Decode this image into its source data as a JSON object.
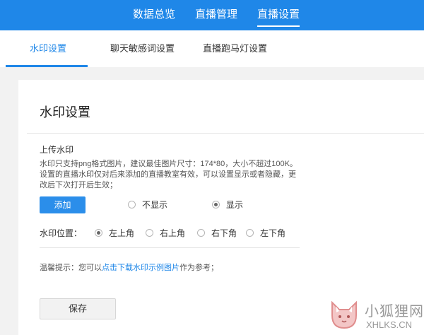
{
  "top_nav": {
    "items": [
      {
        "label": "数据总览"
      },
      {
        "label": "直播管理"
      },
      {
        "label": "直播设置"
      }
    ],
    "active_index": 2
  },
  "sub_tabs": {
    "items": [
      {
        "label": "水印设置"
      },
      {
        "label": "聊天敏感词设置"
      },
      {
        "label": "直播跑马灯设置"
      }
    ],
    "active_index": 0
  },
  "panel": {
    "title": "水印设置",
    "upload_label": "上传水印",
    "description": "水印只支持png格式图片，建议最佳图片尺寸：174*80，大小不超过100K。设置的直播水印仅对后来添加的直播教室有效，可以设置显示或者隐藏，更改后下次打开后生效；",
    "add_button": "添加",
    "visibility": {
      "options": [
        "不显示",
        "显示"
      ],
      "selected": "显示"
    },
    "position": {
      "label": "水印位置：",
      "options": [
        "左上角",
        "右上角",
        "右下角",
        "左下角"
      ],
      "selected": "左上角"
    },
    "tip": {
      "prefix": "温馨提示：您可以",
      "link": "点击下载水印示例图片",
      "suffix": "作为参考；"
    },
    "save_button": "保存"
  },
  "watermark": {
    "cn": "小狐狸网",
    "en": "XHLKS.CN"
  },
  "colors": {
    "brand": "#1f87e8",
    "button": "#2b8eea"
  }
}
